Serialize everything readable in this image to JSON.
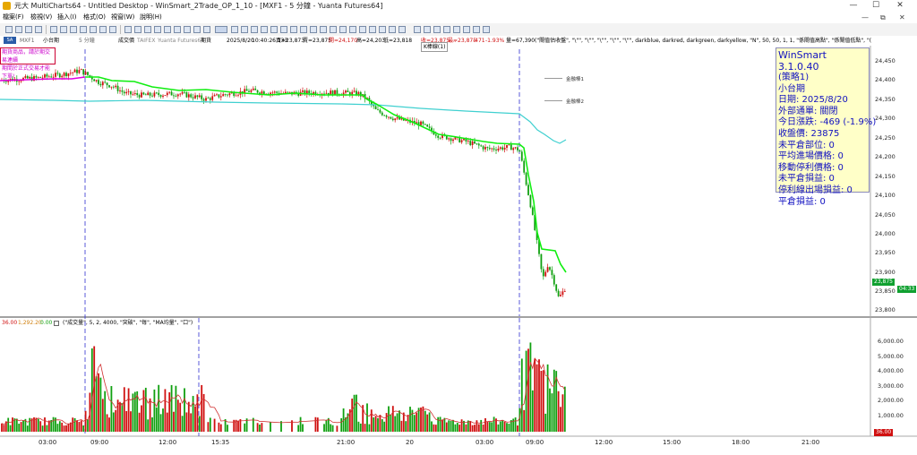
{
  "window": {
    "title": "元大 MultiCharts64 - Untitled Desktop - WinSmart_2Trade_OP_1_10 - [MXF1 - 5 分鐘 - Yuanta Futures64]",
    "controls": [
      "—",
      "☐",
      "✕"
    ]
  },
  "menu": {
    "items": [
      "檔案(F)",
      "檢視(V)",
      "插入(I)",
      "格式(O)",
      "視窗(W)",
      "說明(H)"
    ],
    "controls": [
      "—",
      "⧉",
      "✕"
    ]
  },
  "statusline": {
    "tag": "SA",
    "symbol": "MXF1",
    "name": "小台期",
    "interval": "5 分鐘",
    "type": "成交價",
    "exchange": "TAIFEX",
    "source": "Yuanta Futures64",
    "kind": "期貨",
    "date": "2025/8/20",
    "time": "10:40:26.133",
    "bid": "買=23,873",
    "ask": "賣=23,875",
    "open": "開=24,170",
    "high": "高=24,203",
    "low": "低=23,818",
    "close_chg": "收=23,875 ...",
    "last": "最=23,875",
    "change": "-471",
    "change_pct": "-1.93%",
    "volume": "量=67,390",
    "indicator": "(\"閘值估收盤\", \"\\\"\", \"\\\"\", \"\\\"\", \"\\\"\", \"\\\"\", darkblue, darkred, darkgreen, darkyellow, \"N\", 50, 50, 1, 1, \"係閘值高點\", \"係閘值低點\", \"("
  },
  "tooltip": "K棒線(1)",
  "warning": {
    "line1": "期貨商品，請於期交易連續",
    "line2": "期間於正式交易才能下單!"
  },
  "infobox": {
    "title": "WinSmart 3.1.0.40",
    "lines": [
      "(策略1)",
      "小台期",
      "日期: 2025/8/20",
      "外部通單: 關閉",
      "今日漲跌: -469 (-1.9%)",
      "收盤價: 23875",
      "未平倉部位: 0",
      "平均進場價格: 0",
      "移動停利價格: 0",
      "未平倉損益: 0",
      "停利線出場損益: 0",
      "平倉損益: 0"
    ]
  },
  "legend": {
    "line1": "金融棒1",
    "line2": "金融棒2"
  },
  "price_axis": {
    "ticks": [
      "24,450",
      "24,400",
      "24,350",
      "24,300",
      "24,250",
      "24,200",
      "24,150",
      "24,100",
      "24,050",
      "24,000",
      "23,950",
      "23,900",
      "23,850",
      "23,800"
    ],
    "current_price": "23,875",
    "current_time": "04:33"
  },
  "volume_panel": {
    "header_values": [
      "36.00",
      "1,292.20",
      "0.00"
    ],
    "indicator": "(\"成交量\", 5, 2, 4000, \"突破\", \"毎\", \"MA均量\", \"口\")",
    "ticks": [
      "6,000.00",
      "5,000.00",
      "4,000.00",
      "3,000.00",
      "2,000.00",
      "1,000.00"
    ],
    "current": "36.00"
  },
  "time_axis": [
    "03:00",
    "09:00",
    "12:00",
    "15:35",
    "21:00",
    "20",
    "03:00",
    "09:00",
    "12:00",
    "15:00",
    "18:00",
    "21:00"
  ],
  "colors": {
    "magenta": "#e000e0",
    "cyan": "#40d0d0",
    "green": "#10ee10",
    "up": "#d01010",
    "down": "#10a010",
    "session": "#3030d0"
  }
}
